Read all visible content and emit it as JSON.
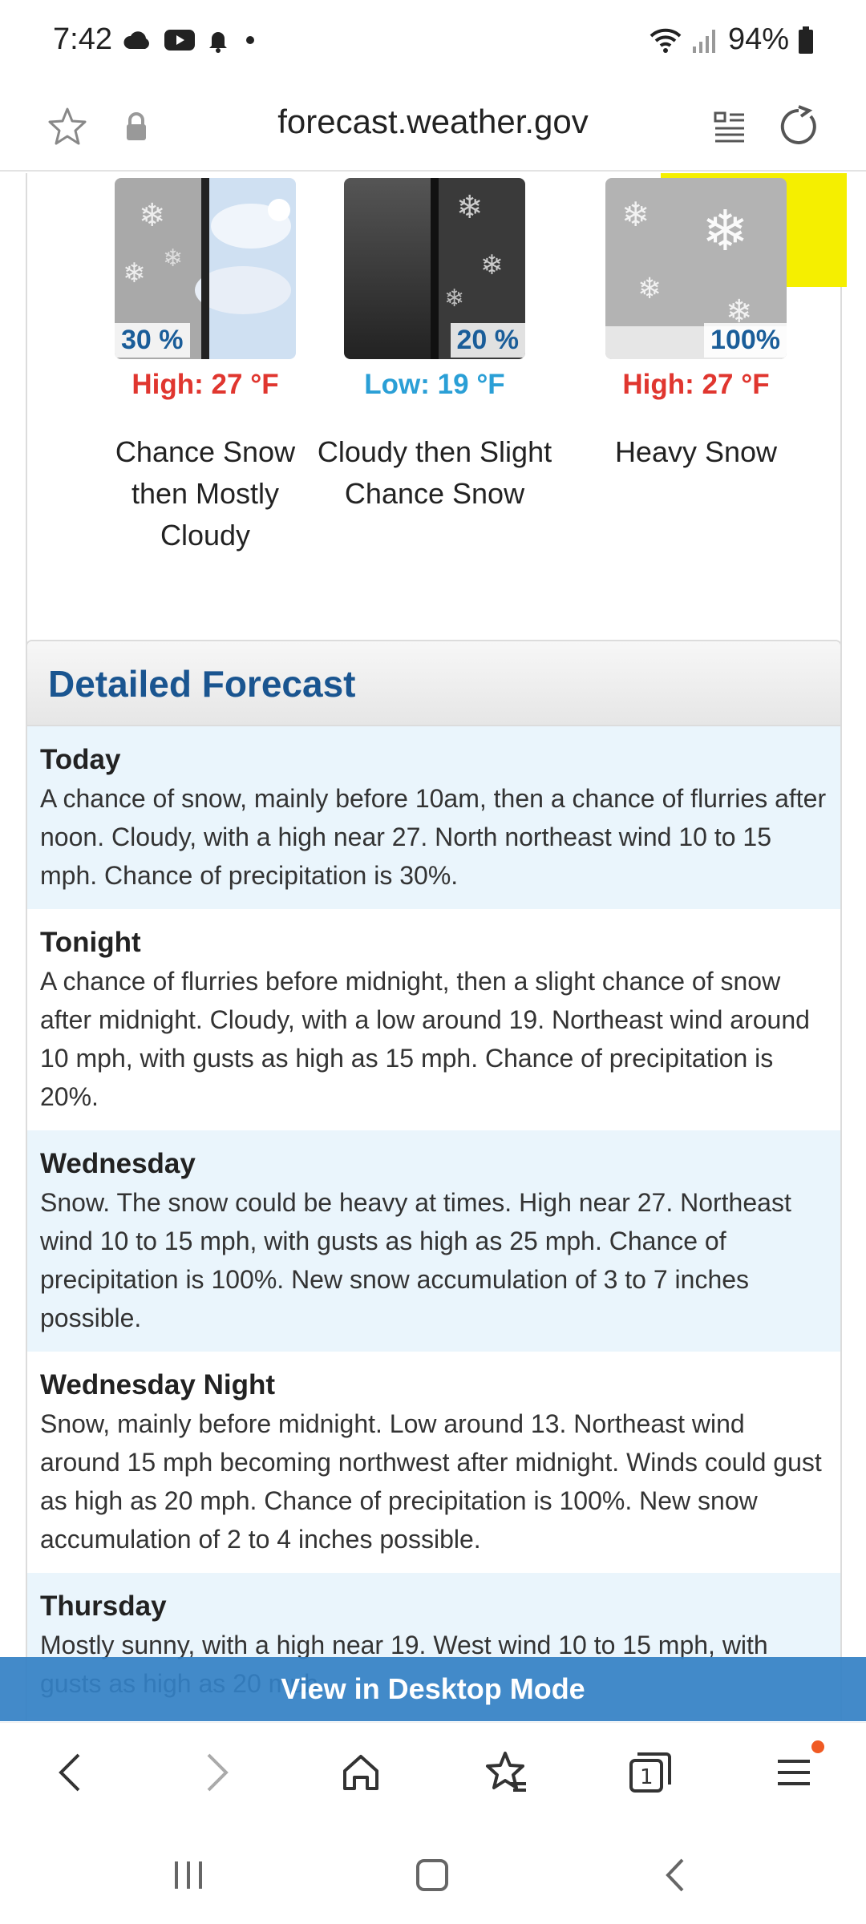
{
  "status": {
    "time": "7:42",
    "battery": "94%",
    "left_icons": [
      "cloud-icon",
      "youtube-icon",
      "bell-icon",
      "dot-icon"
    ],
    "right_icons": [
      "wifi-icon",
      "signal-icon",
      "battery-icon"
    ]
  },
  "browser": {
    "url": "forecast.weather.gov"
  },
  "periods": [
    {
      "temp": "High: 27 °F",
      "temp_kind": "high",
      "pct": "30 %",
      "short": "Chance Snow then Mostly Cloudy"
    },
    {
      "temp": "Low: 19 °F",
      "temp_kind": "low",
      "pct": "20 %",
      "short": "Cloudy then Slight Chance Snow"
    },
    {
      "temp": "High: 27 °F",
      "temp_kind": "high",
      "pct": "100%",
      "short": "Heavy Snow"
    }
  ],
  "detailed": {
    "title": "Detailed Forecast",
    "rows": [
      {
        "label": "Today",
        "text": "A chance of snow, mainly before 10am, then a chance of flurries after noon. Cloudy, with a high near 27. North northeast wind 10 to 15 mph. Chance of precipitation is 30%."
      },
      {
        "label": "Tonight",
        "text": "A chance of flurries before midnight, then a slight chance of snow after midnight. Cloudy, with a low around 19. Northeast wind around 10 mph, with gusts as high as 15 mph. Chance of precipitation is 20%."
      },
      {
        "label": "Wednesday",
        "text": "Snow. The snow could be heavy at times. High near 27. Northeast wind 10 to 15 mph, with gusts as high as 25 mph. Chance of precipitation is 100%. New snow accumulation of 3 to 7 inches possible."
      },
      {
        "label": "Wednesday Night",
        "text": "Snow, mainly before midnight. Low around 13. Northeast wind around 15 mph becoming northwest after midnight. Winds could gust as high as 20 mph. Chance of precipitation is 100%. New snow accumulation of 2 to 4 inches possible."
      },
      {
        "label": "Thursday",
        "text": "Mostly sunny, with a high near 19. West wind 10 to 15 mph, with gusts as high as 20 mph."
      }
    ]
  },
  "banner": {
    "label": "View in Desktop Mode"
  },
  "colors": {
    "high": "#e0362f",
    "low": "#2a9fd6",
    "title": "#1a5590",
    "banner": "#3380c4",
    "shaded_row": "#eaf5fc",
    "notification_dot": "#f05a23"
  }
}
